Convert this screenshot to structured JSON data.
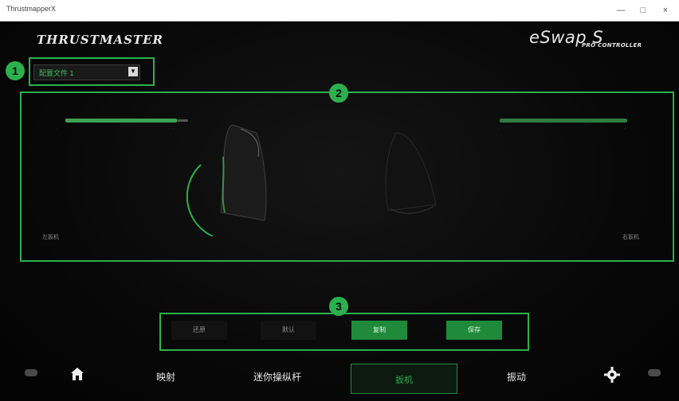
{
  "window": {
    "title": "ThrustmapperX",
    "minimize": "—",
    "maximize": "□",
    "close": "×"
  },
  "brand": {
    "logo": "THRUSTMASTER",
    "product": "eSwap S",
    "product_sub": "PRO CONTROLLER"
  },
  "profile": {
    "selected": "配置文件 1"
  },
  "callouts": [
    "1",
    "2",
    "3"
  ],
  "panel": {
    "left_label": "左扳机",
    "right_label": "右扳机"
  },
  "actions": [
    "还原",
    "默认",
    "复制",
    "保存"
  ],
  "nav": {
    "items": [
      "映射",
      "迷你操纵杆",
      "扳机",
      "振动"
    ],
    "active": "扳机"
  },
  "icons": {
    "left_edge": "controller-left-icon",
    "home": "home-icon",
    "settings": "gear-icon",
    "right_edge": "controller-right-icon"
  }
}
